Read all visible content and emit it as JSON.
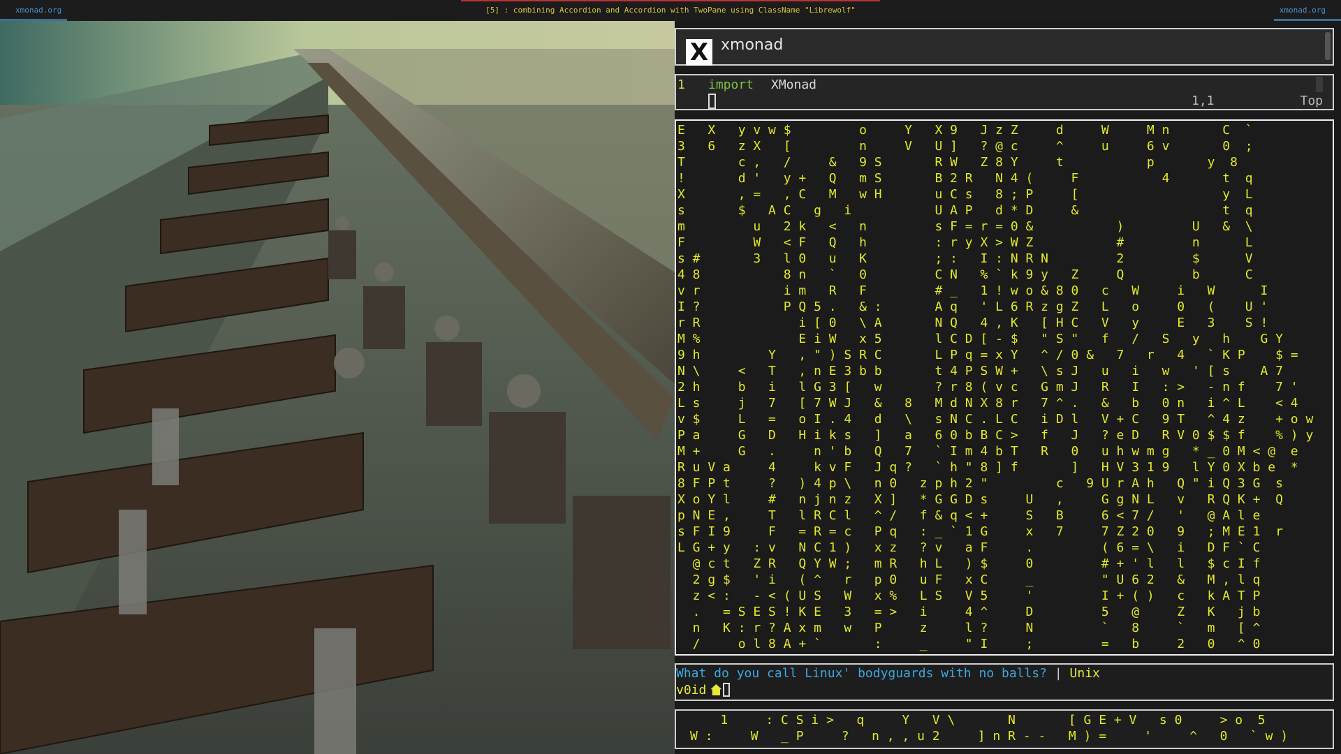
{
  "topbar": {
    "left_workspace": "xmonad.org",
    "title": "[5] : combining Accordion and Accordion with TwoPane using ClassName \"Librewolf\"",
    "right_workspace": "xmonad.org"
  },
  "browser": {
    "title": "xmonad",
    "logo_letter": "X"
  },
  "editor": {
    "line_number": "1",
    "keyword": "import",
    "module": "XMonad",
    "cursor_position": "1,1",
    "scroll_position": "Top"
  },
  "matrix": {
    "text": "E   X   y v w $         o     Y   X 9   J z Z     d     W     M n       C  `\n3   6   z X   [         n     V   U ]   ? @ c     ^     u     6 v       0  ;\nT       c ,   /     &   9 S       R W   Z 8 Y     t           p       y  8\n!       d '   y +   Q   m S       B 2 R   N 4 (     F           4       t  q\nX       , =   , C   M   w H       u C s   8 ; P     [                   y  L\ns       $   A C   g   i           U A P   d * D     &                   t  q\nm         u   2 k   <   n         s F = r = 0 &           )         U   &  \\\nF         W   < F   Q   h         : r y X > W Z           #         n      L\ns #       3   l 0   u   K         ; :   I : N R N         2         $      V\n4 8           8 n   `   0         C N   % ` k 9 y   Z     Q         b      C\nv r           i m   R   F         # _   1 ! w o & 8 0   c   W     i   W      I\nI ?           P Q 5 .   & :       A q   ' L 6 R z g Z   L   o     0   (    U '\nr R             i [ 0   \\ A       N Q   4 , K   [ H C   V   y     E   3    S !\nM %             E i W   x 5       l C D [ - $   \" S \"   f   /   S   y   h    G Y\n9 h         Y   , \" ) S R C       L P q = x Y   ^ / 0 &   7   r   4   ` K P    $ =\nN \\     <   T   , n E 3 b b       t 4 P S W +   \\ s J   u   i   w   ' [ s    A 7\n2 h     b   i   l G 3 [   w       ? r 8 ( v c   G m J   R   I   : >   - n f    7 '\nL s     j   7   [ 7 W J   &   8   M d N X 8 r   7 ^ .   &   b   0 n   i ^ L    < 4\nv $     L   =   o I . 4   d   \\   s N C . L C   i D l   V + C   9 T   ^ 4 z    + o w\nP a     G   D   H i k s   ]   a   6 0 b B C >   f   J   ? e D   R V 0 $ $ f    % ) y\nM +     G   .     n ' b   Q   7   ` I m 4 b T   R   0   u h w m g   * _ 0 M < @  e\nR u V a     4     k v F   J q ?   ` h \" 8 ] f       ]   H V 3 1 9   l Y 0 X b e  *\n8 F P t     ?   ) 4 p \\   n 0   z p h 2 \"         c   9 U r A h   Q \" i Q 3 G  s\nX o Y l     #   n j n z   X ]   * G G D s     U   ,     G g N L   v   R Q K +  Q\np N E ,     T   l R C l   ^ /   f & q < +     S   B     6 < 7 /   '   @ A l e\ns F I 9     F   = R = c   P q   : _ ` 1 G     x   7     7 Z 2 0   9   ; M E 1  r\nL G + y   : v   N C 1 )   x z   ? v   a F     .         ( 6 = \\   i   D F ` C\n  @ c t   Z R   Q Y W ;   m R   h L   ) $     0         # + ' l   l   $ c I f\n  2 g $   ' i   ( ^   r   p 0   u F   x C     _         \" U 6 2   &   M , l q\n  z < :   - < ( U S   W   x %   L S   V 5     '         I + ( )   c   k A T P\n  .   = S E S ! K E   3   = >   i     4 ^     D         5   @     Z   K   j b\n  n   K : r ? A x m   w   P     z     l ?     N         `   8     `   m   [ ^\n  /     o l 8 A + `       :     _     \" I     ;         =   b     2   0   ^ 0"
  },
  "shell": {
    "question": "What do you call Linux' bodyguards with no balls?",
    "separator": "|",
    "answer": "Unix",
    "prompt_user": "v0id"
  },
  "bottom_matrix": {
    "text": "    1     : C S i >   q     Y   V \\       N       [ G E + V   s 0     > o  5\nW :     W   _ P     ?   n , , u 2     ] n R - -   M ) =     '     ^   0   ` w )"
  },
  "colors": {
    "matrix_text": "#e2e82a",
    "shell_question": "#3aa9e0",
    "shell_answer": "#e8e83a",
    "topbar_title": "#d8c43a",
    "topbar_workspace": "#4a8fc7",
    "editor_keyword": "#7ec243"
  }
}
